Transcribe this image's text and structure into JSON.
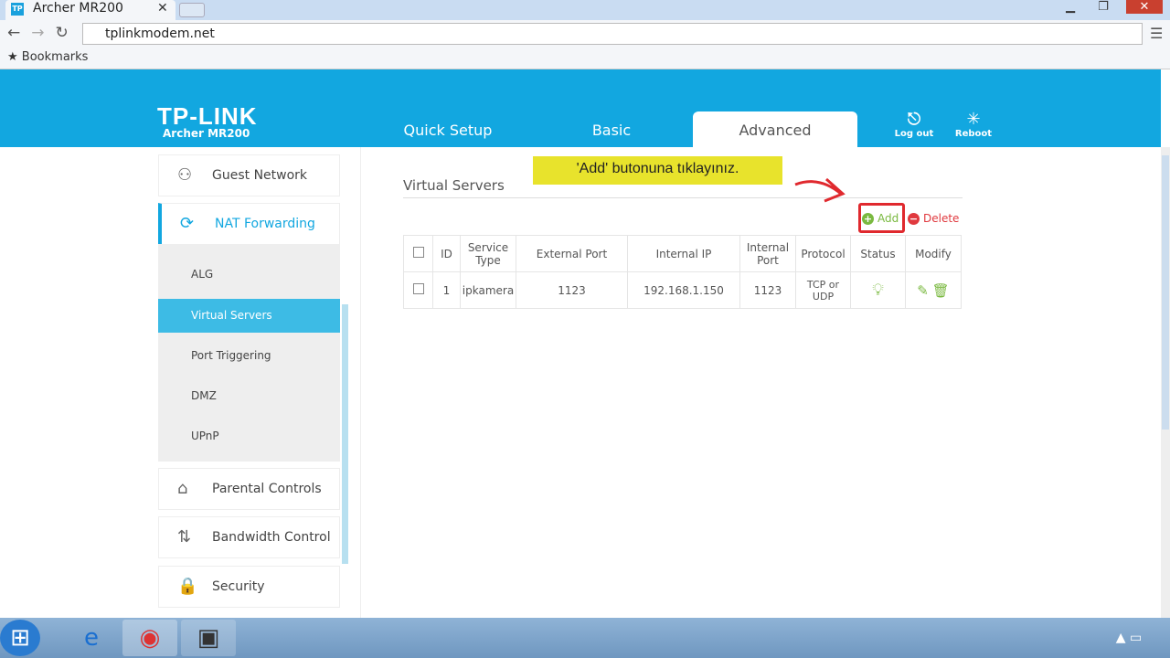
{
  "browser": {
    "tab_title": "Archer MR200",
    "favicon": "TP",
    "url": "tplinkmodem.net",
    "bookmarks_label": "Bookmarks"
  },
  "header": {
    "logo": "TP-LINK",
    "model": "Archer MR200",
    "tabs": [
      {
        "label": "Quick Setup"
      },
      {
        "label": "Basic"
      },
      {
        "label": "Advanced"
      }
    ],
    "logout": "Log out",
    "reboot": "Reboot",
    "accent": "#12a7e0"
  },
  "sidebar": {
    "items": [
      {
        "label": "Guest Network"
      },
      {
        "label": "NAT Forwarding"
      },
      {
        "label": "Parental Controls"
      },
      {
        "label": "Bandwidth Control"
      },
      {
        "label": "Security"
      }
    ],
    "sub": [
      {
        "label": "ALG"
      },
      {
        "label": "Virtual Servers"
      },
      {
        "label": "Port Triggering"
      },
      {
        "label": "DMZ"
      },
      {
        "label": "UPnP"
      }
    ]
  },
  "main": {
    "title": "Virtual Servers",
    "annotation": "'Add' butonuna tıklayınız.",
    "add": "Add",
    "delete": "Delete",
    "columns": [
      "ID",
      "Service Type",
      "External Port",
      "Internal IP",
      "Internal Port",
      "Protocol",
      "Status",
      "Modify"
    ],
    "rows": [
      {
        "id": "1",
        "service": "ipkamera",
        "ext": "1123",
        "ip": "192.168.1.150",
        "int": "1123",
        "proto": "TCP or UDP"
      }
    ]
  }
}
